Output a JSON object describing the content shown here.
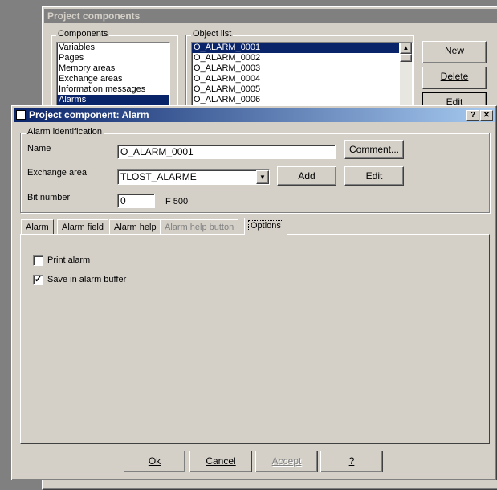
{
  "bg_window": {
    "title": "Project components",
    "components_label": "Components",
    "components": [
      "Variables",
      "Pages",
      "Memory areas",
      "Exchange areas",
      "Information messages",
      "Alarms"
    ],
    "object_list_label": "Object list",
    "objects": [
      "O_ALARM_0001",
      "O_ALARM_0002",
      "O_ALARM_0003",
      "O_ALARM_0004",
      "O_ALARM_0005",
      "O_ALARM_0006"
    ],
    "new_label": "New",
    "delete_label": "Delete",
    "edit_label": "Edit"
  },
  "dialog": {
    "title": "Project component: Alarm",
    "help_btn": "?",
    "close_btn": "✕",
    "identification_label": "Alarm identification",
    "name_label": "Name",
    "name_value": "O_ALARM_0001",
    "comment_label": "Comment...",
    "exchange_label": "Exchange area",
    "exchange_value": "TLOST_ALARME",
    "add_label": "Add",
    "edit_label": "Edit",
    "bit_label": "Bit number",
    "bit_value": "0",
    "bit_suffix": "F 500",
    "tabs": [
      "Alarm",
      "Alarm field",
      "Alarm help",
      "Alarm help button",
      "Options"
    ],
    "print_alarm_label": "Print alarm",
    "save_buffer_label": "Save in alarm buffer",
    "ok_label": "Ok",
    "cancel_label": "Cancel",
    "accept_label": "Accept",
    "question_label": "?"
  },
  "colors": {
    "title_active_start": "#0a246a",
    "title_active_end": "#a6caf0",
    "title_inactive": "#808080",
    "face": "#d4d0c8"
  }
}
